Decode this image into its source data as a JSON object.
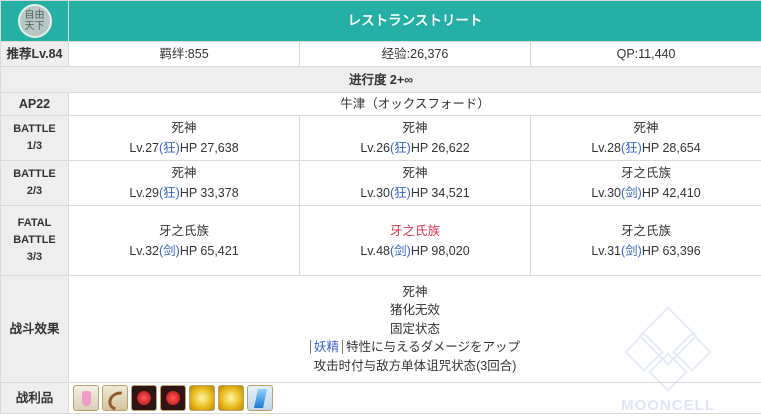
{
  "logo": {
    "icon": "seal-icon",
    "lines": [
      "自由",
      "天下"
    ]
  },
  "title": "レストランストリート",
  "recommended_level": "推荐Lv.84",
  "bond": "羁绊:855",
  "exp": "经验:26,376",
  "qp": "QP:11,440",
  "progress": "进行度 2+∞",
  "ap": "AP22",
  "location": "牛津（オックスフォード）",
  "battles": [
    {
      "label_lines": [
        "BATTLE",
        "1/3"
      ],
      "enemies": [
        {
          "name": "死神",
          "level": "Lv.27",
          "class": "(狂)",
          "hp": "HP 27,638"
        },
        {
          "name": "死神",
          "level": "Lv.26",
          "class": "(狂)",
          "hp": "HP 26,622"
        },
        {
          "name": "死神",
          "level": "Lv.28",
          "class": "(狂)",
          "hp": "HP 28,654"
        }
      ]
    },
    {
      "label_lines": [
        "BATTLE",
        "2/3"
      ],
      "enemies": [
        {
          "name": "死神",
          "level": "Lv.29",
          "class": "(狂)",
          "hp": "HP 33,378"
        },
        {
          "name": "死神",
          "level": "Lv.30",
          "class": "(狂)",
          "hp": "HP 34,521"
        },
        {
          "name": "牙之氏族",
          "level": "Lv.30",
          "class": "(剑)",
          "hp": "HP 42,410"
        }
      ]
    },
    {
      "label_lines": [
        "FATAL",
        "BATTLE",
        "3/3"
      ],
      "enemies": [
        {
          "name": "牙之氏族",
          "level": "Lv.32",
          "class": "(剑)",
          "hp": "HP 65,421"
        },
        {
          "name": "牙之氏族",
          "level": "Lv.48",
          "class": "(剑)",
          "hp": "HP 98,020",
          "highlight_color": "#e0314d"
        },
        {
          "name": "牙之氏族",
          "level": "Lv.31",
          "class": "(剑)",
          "hp": "HP 63,396"
        }
      ]
    }
  ],
  "effects": {
    "label": "战斗效果",
    "lines": [
      "死神",
      "猪化无效",
      "固定状态"
    ],
    "trait_tag": "妖精",
    "trait_text": "特性に与えるダメージをアップ",
    "last_line": "攻击时付与敌方单体诅咒状态(3回合)"
  },
  "spoils": {
    "label": "战利品",
    "items": [
      "vial-icon",
      "horn-icon",
      "red-gem-icon",
      "red-gem-icon",
      "gold-icon",
      "gold-icon",
      "crystal-icon"
    ]
  },
  "watermark": "MOONCELL",
  "colors": {
    "header": "#25b0a6",
    "highlight": "#e0314d",
    "class_text": "#3a63c8"
  }
}
